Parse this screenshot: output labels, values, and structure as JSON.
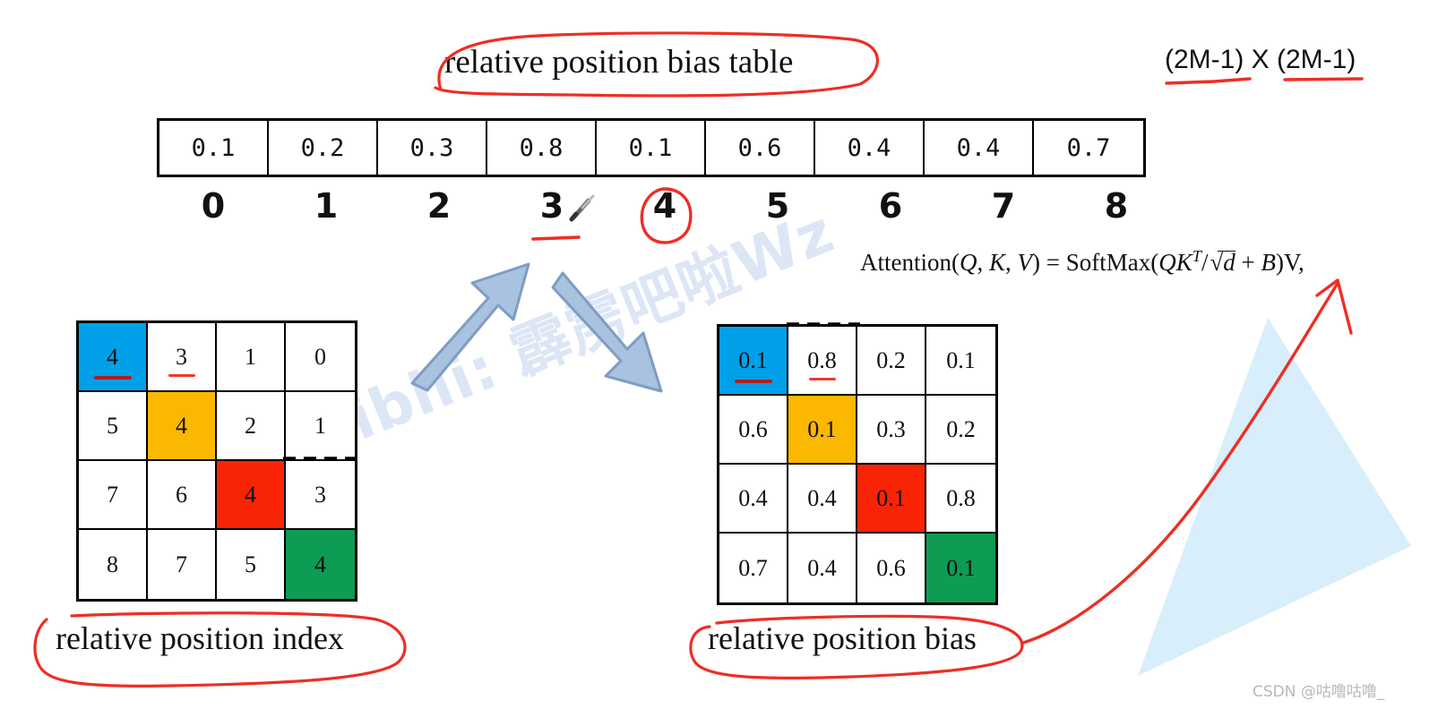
{
  "labels": {
    "bias_table_title": "relative position bias table",
    "dimension_note": "(2M-1) X (2M-1)",
    "index_matrix_title": "relative position index",
    "bias_matrix_title": "relative position bias",
    "credit": "CSDN @咕噜咕噜_",
    "watermark": "Bilibili: 霹雳吧啦Wz"
  },
  "bias_table": {
    "values": [
      "0.1",
      "0.2",
      "0.3",
      "0.8",
      "0.1",
      "0.6",
      "0.4",
      "0.4",
      "0.7"
    ],
    "indices": [
      "0",
      "1",
      "2",
      "3",
      "4",
      "5",
      "6",
      "7",
      "8"
    ],
    "highlighted_index": "4",
    "underlined_index": "3"
  },
  "index_matrix": {
    "rows": [
      [
        "4",
        "3",
        "1",
        "0"
      ],
      [
        "5",
        "4",
        "2",
        "1"
      ],
      [
        "7",
        "6",
        "4",
        "3"
      ],
      [
        "8",
        "7",
        "5",
        "4"
      ]
    ],
    "cell_colors": [
      [
        "#00a0e9",
        "",
        "",
        ""
      ],
      [
        "",
        "#fbb800",
        "",
        ""
      ],
      [
        "",
        "",
        "#f92405",
        ""
      ],
      [
        "",
        "",
        "",
        "#0e9b54"
      ]
    ]
  },
  "bias_matrix": {
    "rows": [
      [
        "0.1",
        "0.8",
        "0.2",
        "0.1"
      ],
      [
        "0.6",
        "0.1",
        "0.3",
        "0.2"
      ],
      [
        "0.4",
        "0.4",
        "0.1",
        "0.8"
      ],
      [
        "0.7",
        "0.4",
        "0.6",
        "0.1"
      ]
    ],
    "cell_colors": [
      [
        "#00a0e9",
        "",
        "",
        ""
      ],
      [
        "",
        "#fbb800",
        "",
        ""
      ],
      [
        "",
        "",
        "#f92405",
        ""
      ],
      [
        "",
        "",
        "",
        "#0e9b54"
      ]
    ]
  },
  "formula": {
    "text": "Attention(Q, K, V) = SoftMax(QK^T / sqrt(d) + B)V,",
    "lhs": "Attention(",
    "q": "Q",
    "comma1": ", ",
    "k": "K",
    "comma2": ", ",
    "v": "V",
    "eq": ") = SoftMax(",
    "qk": "QK",
    "t_sup": "T",
    "slash": "/",
    "radical": "√",
    "d": "d",
    "plus": " + ",
    "b": "B",
    "tail": ")V,"
  },
  "colors": {
    "blue": "#00a0e9",
    "orange": "#fbb800",
    "red": "#f92405",
    "green": "#0e9b54",
    "annotation_red": "#ee2e24",
    "arrow_blue": "#a8c2e0",
    "arrow_blue_stroke": "#7f9dc2",
    "watermark": "#dce6f5",
    "triangle": "#d8eefb"
  }
}
